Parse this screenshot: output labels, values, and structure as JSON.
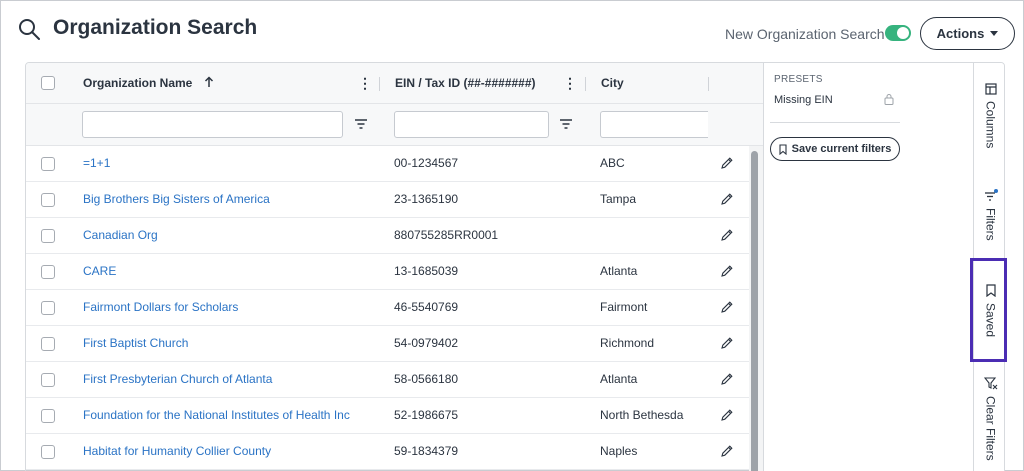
{
  "header": {
    "title": "Organization Search",
    "toggle_label": "New Organization Search",
    "toggle_on": true,
    "actions_label": "Actions"
  },
  "grid": {
    "columns": [
      {
        "label": "Organization Name",
        "sort": "ascending"
      },
      {
        "label": "EIN / Tax ID (##-#######)"
      },
      {
        "label": "City"
      }
    ],
    "rows": [
      {
        "name": "=1+1",
        "ein": "00-1234567",
        "city": "ABC"
      },
      {
        "name": "Big Brothers Big Sisters of America",
        "ein": "23-1365190",
        "city": "Tampa"
      },
      {
        "name": "Canadian Org",
        "ein": "880755285RR0001",
        "city": ""
      },
      {
        "name": "CARE",
        "ein": "13-1685039",
        "city": "Atlanta"
      },
      {
        "name": "Fairmont Dollars for Scholars",
        "ein": "46-5540769",
        "city": "Fairmont"
      },
      {
        "name": "First Baptist Church",
        "ein": "54-0979402",
        "city": "Richmond"
      },
      {
        "name": "First Presbyterian Church of Atlanta",
        "ein": "58-0566180",
        "city": "Atlanta"
      },
      {
        "name": "Foundation for the National Institutes of Health Inc",
        "ein": "52-1986675",
        "city": "North Bethesda"
      },
      {
        "name": "Habitat for Humanity Collier County",
        "ein": "59-1834379",
        "city": "Naples"
      }
    ]
  },
  "presets": {
    "heading": "PRESETS",
    "items": [
      {
        "label": "Missing EIN",
        "locked": true
      }
    ],
    "save_label": "Save current filters"
  },
  "sidebar": {
    "tabs": [
      {
        "label": "Columns",
        "icon": "columns-icon"
      },
      {
        "label": "Filters",
        "icon": "filter-icon"
      },
      {
        "label": "Saved",
        "icon": "bookmark-icon",
        "highlighted": true
      },
      {
        "label": "Clear Filters",
        "icon": "clear-filter-icon"
      }
    ]
  },
  "colors": {
    "accent_toggle": "#36b37e",
    "link": "#2a73c5",
    "highlight_border": "#4b2db3",
    "filter_dot": "#2a73c5"
  }
}
